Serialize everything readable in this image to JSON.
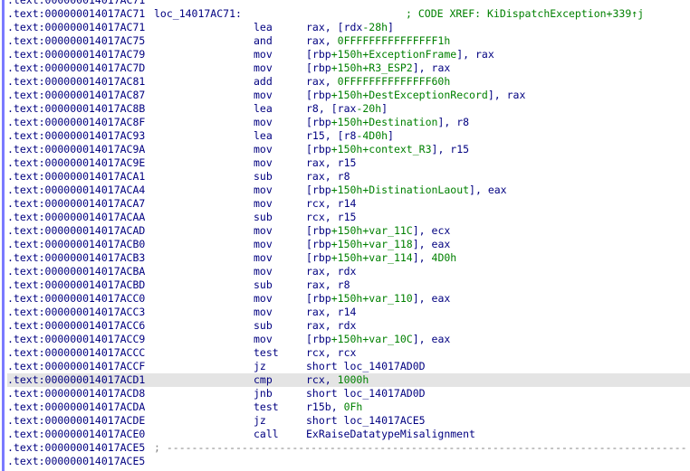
{
  "colors": {
    "address": "#000080",
    "mnemonic": "#000080",
    "register": "#000080",
    "immediate": "#008000",
    "variable": "#008000",
    "comment": "#008000",
    "separator": "#808080",
    "highlight_row": "#e4e4e4",
    "gutter_bar": "#7a7aff"
  },
  "listing": [
    {
      "addr": ".text:000000014017AC71",
      "partial": true
    },
    {
      "addr": ".text:000000014017AC71",
      "label": "loc_14017AC71:",
      "comment": "; CODE XREF: KiDispatchException+339↑j"
    },
    {
      "addr": ".text:000000014017AC71",
      "mnem": "lea",
      "ops": [
        [
          "r",
          "rax"
        ],
        [
          "p",
          ", ["
        ],
        [
          "r",
          "rdx"
        ],
        [
          "n",
          "-28h"
        ],
        [
          "p",
          "]"
        ]
      ]
    },
    {
      "addr": ".text:000000014017AC75",
      "mnem": "and",
      "ops": [
        [
          "r",
          "rax"
        ],
        [
          "p",
          ", "
        ],
        [
          "n",
          "0FFFFFFFFFFFFFFF1h"
        ]
      ]
    },
    {
      "addr": ".text:000000014017AC79",
      "mnem": "mov",
      "ops": [
        [
          "p",
          "["
        ],
        [
          "r",
          "rbp"
        ],
        [
          "n",
          "+150h"
        ],
        [
          "v",
          "+ExceptionFrame"
        ],
        [
          "p",
          "], "
        ],
        [
          "r",
          "rax"
        ]
      ]
    },
    {
      "addr": ".text:000000014017AC7D",
      "mnem": "mov",
      "ops": [
        [
          "p",
          "["
        ],
        [
          "r",
          "rbp"
        ],
        [
          "n",
          "+150h"
        ],
        [
          "v",
          "+R3_ESP2"
        ],
        [
          "p",
          "], "
        ],
        [
          "r",
          "rax"
        ]
      ]
    },
    {
      "addr": ".text:000000014017AC81",
      "mnem": "add",
      "ops": [
        [
          "r",
          "rax"
        ],
        [
          "p",
          ", "
        ],
        [
          "n",
          "0FFFFFFFFFFFFFF60h"
        ]
      ]
    },
    {
      "addr": ".text:000000014017AC87",
      "mnem": "mov",
      "ops": [
        [
          "p",
          "["
        ],
        [
          "r",
          "rbp"
        ],
        [
          "n",
          "+150h"
        ],
        [
          "v",
          "+DestExceptionRecord"
        ],
        [
          "p",
          "], "
        ],
        [
          "r",
          "rax"
        ]
      ]
    },
    {
      "addr": ".text:000000014017AC8B",
      "mnem": "lea",
      "ops": [
        [
          "r",
          "r8"
        ],
        [
          "p",
          ", ["
        ],
        [
          "r",
          "rax"
        ],
        [
          "n",
          "-20h"
        ],
        [
          "p",
          "]"
        ]
      ]
    },
    {
      "addr": ".text:000000014017AC8F",
      "mnem": "mov",
      "ops": [
        [
          "p",
          "["
        ],
        [
          "r",
          "rbp"
        ],
        [
          "n",
          "+150h"
        ],
        [
          "v",
          "+Destination"
        ],
        [
          "p",
          "], "
        ],
        [
          "r",
          "r8"
        ]
      ]
    },
    {
      "addr": ".text:000000014017AC93",
      "mnem": "lea",
      "ops": [
        [
          "r",
          "r15"
        ],
        [
          "p",
          ", ["
        ],
        [
          "r",
          "r8"
        ],
        [
          "n",
          "-4D0h"
        ],
        [
          "p",
          "]"
        ]
      ]
    },
    {
      "addr": ".text:000000014017AC9A",
      "mnem": "mov",
      "ops": [
        [
          "p",
          "["
        ],
        [
          "r",
          "rbp"
        ],
        [
          "n",
          "+150h"
        ],
        [
          "v",
          "+context_R3"
        ],
        [
          "p",
          "], "
        ],
        [
          "r",
          "r15"
        ]
      ]
    },
    {
      "addr": ".text:000000014017AC9E",
      "mnem": "mov",
      "ops": [
        [
          "r",
          "rax"
        ],
        [
          "p",
          ", "
        ],
        [
          "r",
          "r15"
        ]
      ]
    },
    {
      "addr": ".text:000000014017ACA1",
      "mnem": "sub",
      "ops": [
        [
          "r",
          "rax"
        ],
        [
          "p",
          ", "
        ],
        [
          "r",
          "r8"
        ]
      ]
    },
    {
      "addr": ".text:000000014017ACA4",
      "mnem": "mov",
      "ops": [
        [
          "p",
          "["
        ],
        [
          "r",
          "rbp"
        ],
        [
          "n",
          "+150h"
        ],
        [
          "v",
          "+DistinationLaout"
        ],
        [
          "p",
          "], "
        ],
        [
          "r",
          "eax"
        ]
      ]
    },
    {
      "addr": ".text:000000014017ACA7",
      "mnem": "mov",
      "ops": [
        [
          "r",
          "rcx"
        ],
        [
          "p",
          ", "
        ],
        [
          "r",
          "r14"
        ]
      ]
    },
    {
      "addr": ".text:000000014017ACAA",
      "mnem": "sub",
      "ops": [
        [
          "r",
          "rcx"
        ],
        [
          "p",
          ", "
        ],
        [
          "r",
          "r15"
        ]
      ]
    },
    {
      "addr": ".text:000000014017ACAD",
      "mnem": "mov",
      "ops": [
        [
          "p",
          "["
        ],
        [
          "r",
          "rbp"
        ],
        [
          "n",
          "+150h"
        ],
        [
          "v",
          "+var_11C"
        ],
        [
          "p",
          "], "
        ],
        [
          "r",
          "ecx"
        ]
      ]
    },
    {
      "addr": ".text:000000014017ACB0",
      "mnem": "mov",
      "ops": [
        [
          "p",
          "["
        ],
        [
          "r",
          "rbp"
        ],
        [
          "n",
          "+150h"
        ],
        [
          "v",
          "+var_118"
        ],
        [
          "p",
          "], "
        ],
        [
          "r",
          "eax"
        ]
      ]
    },
    {
      "addr": ".text:000000014017ACB3",
      "mnem": "mov",
      "ops": [
        [
          "p",
          "["
        ],
        [
          "r",
          "rbp"
        ],
        [
          "n",
          "+150h"
        ],
        [
          "v",
          "+var_114"
        ],
        [
          "p",
          "], "
        ],
        [
          "n",
          "4D0h"
        ]
      ]
    },
    {
      "addr": ".text:000000014017ACBA",
      "mnem": "mov",
      "ops": [
        [
          "r",
          "rax"
        ],
        [
          "p",
          ", "
        ],
        [
          "r",
          "rdx"
        ]
      ]
    },
    {
      "addr": ".text:000000014017ACBD",
      "mnem": "sub",
      "ops": [
        [
          "r",
          "rax"
        ],
        [
          "p",
          ", "
        ],
        [
          "r",
          "r8"
        ]
      ]
    },
    {
      "addr": ".text:000000014017ACC0",
      "mnem": "mov",
      "ops": [
        [
          "p",
          "["
        ],
        [
          "r",
          "rbp"
        ],
        [
          "n",
          "+150h"
        ],
        [
          "v",
          "+var_110"
        ],
        [
          "p",
          "], "
        ],
        [
          "r",
          "eax"
        ]
      ]
    },
    {
      "addr": ".text:000000014017ACC3",
      "mnem": "mov",
      "ops": [
        [
          "r",
          "rax"
        ],
        [
          "p",
          ", "
        ],
        [
          "r",
          "r14"
        ]
      ]
    },
    {
      "addr": ".text:000000014017ACC6",
      "mnem": "sub",
      "ops": [
        [
          "r",
          "rax"
        ],
        [
          "p",
          ", "
        ],
        [
          "r",
          "rdx"
        ]
      ]
    },
    {
      "addr": ".text:000000014017ACC9",
      "mnem": "mov",
      "ops": [
        [
          "p",
          "["
        ],
        [
          "r",
          "rbp"
        ],
        [
          "n",
          "+150h"
        ],
        [
          "v",
          "+var_10C"
        ],
        [
          "p",
          "], "
        ],
        [
          "r",
          "eax"
        ]
      ]
    },
    {
      "addr": ".text:000000014017ACCC",
      "mnem": "test",
      "ops": [
        [
          "r",
          "rcx"
        ],
        [
          "p",
          ", "
        ],
        [
          "r",
          "rcx"
        ]
      ]
    },
    {
      "addr": ".text:000000014017ACCF",
      "mnem": "jz",
      "ops": [
        [
          "r",
          "short "
        ],
        [
          "s",
          "loc_14017AD0D"
        ]
      ]
    },
    {
      "addr": ".text:000000014017ACD1",
      "mnem": "cmp",
      "highlight": true,
      "ops": [
        [
          "r",
          "rcx"
        ],
        [
          "p",
          ", "
        ],
        [
          "n",
          "1000h"
        ]
      ]
    },
    {
      "addr": ".text:000000014017ACD8",
      "mnem": "jnb",
      "ops": [
        [
          "r",
          "short "
        ],
        [
          "s",
          "loc_14017AD0D"
        ]
      ]
    },
    {
      "addr": ".text:000000014017ACDA",
      "mnem": "test",
      "ops": [
        [
          "r",
          "r15b"
        ],
        [
          "p",
          ", "
        ],
        [
          "n",
          "0Fh"
        ]
      ]
    },
    {
      "addr": ".text:000000014017ACDE",
      "mnem": "jz",
      "ops": [
        [
          "r",
          "short "
        ],
        [
          "s",
          "loc_14017ACE5"
        ]
      ]
    },
    {
      "addr": ".text:000000014017ACE0",
      "mnem": "call",
      "ops": [
        [
          "s",
          "ExRaiseDatatypeMisalignment"
        ]
      ]
    },
    {
      "addr": ".text:000000014017ACE5",
      "separator": "; -----------------------------------------------------------------------------------"
    },
    {
      "addr": ".text:000000014017ACE5",
      "partial": true
    }
  ]
}
